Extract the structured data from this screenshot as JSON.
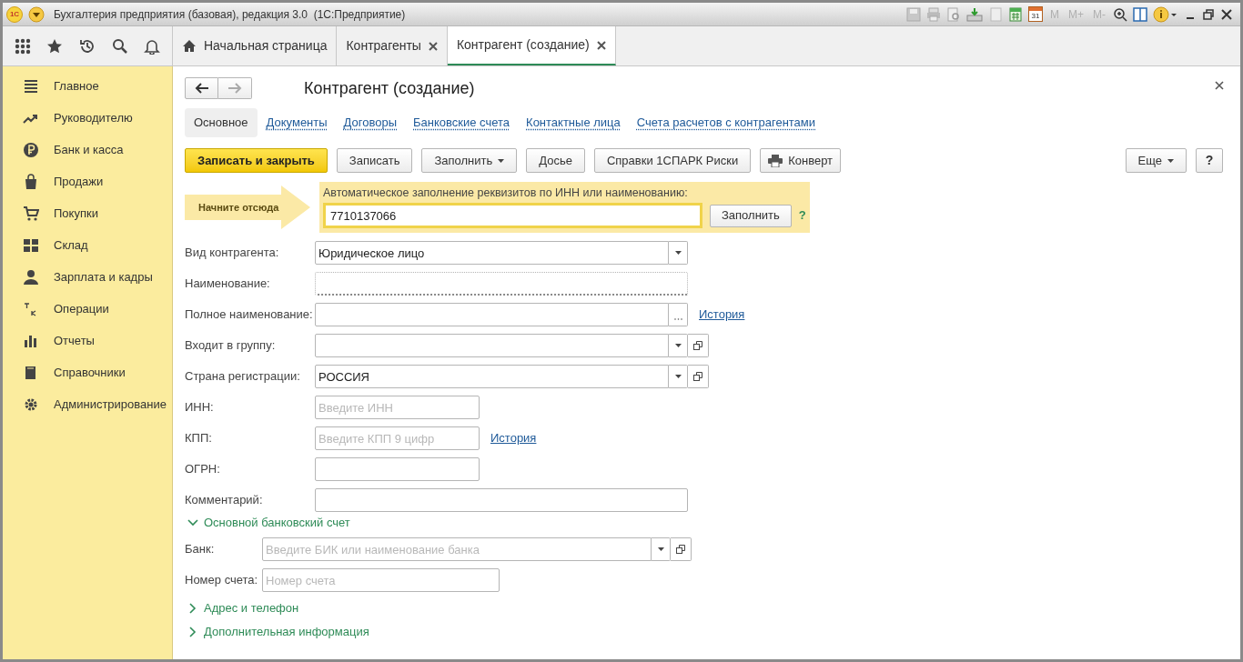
{
  "title_bar": {
    "logo": "1С",
    "title": "Бухгалтерия предприятия (базовая), редакция 3.0  (1С:Предприятие)",
    "calendar_day": "31",
    "memory_buttons": [
      "M",
      "M+",
      "M-"
    ]
  },
  "tabs": [
    {
      "label": "Начальная страница",
      "selected": false,
      "kind": "home"
    },
    {
      "label": "Контрагенты",
      "selected": false,
      "kind": "closable"
    },
    {
      "label": "Контрагент (создание)",
      "selected": true,
      "kind": "closable"
    }
  ],
  "sidebar": {
    "items": [
      "Главное",
      "Руководителю",
      "Банк и касса",
      "Продажи",
      "Покупки",
      "Склад",
      "Зарплата и кадры",
      "Операции",
      "Отчеты",
      "Справочники",
      "Администрирование"
    ]
  },
  "form": {
    "title": "Контрагент (создание)",
    "subtabs": [
      {
        "label": "Основное",
        "selected": true
      },
      {
        "label": "Документы",
        "selected": false
      },
      {
        "label": "Договоры",
        "selected": false
      },
      {
        "label": "Банковские счета",
        "selected": false
      },
      {
        "label": "Контактные лица",
        "selected": false
      },
      {
        "label": "Счета расчетов с контрагентами",
        "selected": false
      }
    ],
    "commands": [
      {
        "label": "Записать и закрыть",
        "kind": "primary"
      },
      {
        "label": "Записать",
        "kind": "plain"
      },
      {
        "label": "Заполнить",
        "kind": "menu"
      },
      {
        "label": "Досье",
        "kind": "plain"
      },
      {
        "label": "Справки 1СПАРК Риски",
        "kind": "plain"
      },
      {
        "label": "Конверт",
        "kind": "print"
      }
    ],
    "more_button": "Еще",
    "help_button": "?",
    "start_hint": "Начните отсюда",
    "autofill": {
      "label": "Автоматическое заполнение реквизитов по ИНН или наименованию:",
      "value": "7710137066",
      "button": "Заполнить",
      "help": "?"
    },
    "fields": [
      {
        "label": "Вид контрагента:",
        "kind": "select",
        "value": "Юридическое лицо",
        "required": false
      },
      {
        "label": "Наименование:",
        "kind": "input",
        "required": true
      },
      {
        "label": "Полное наименование:",
        "kind": "choice",
        "required": false,
        "link": "История"
      },
      {
        "label": "Входит в группу:",
        "kind": "reference",
        "required": false
      },
      {
        "label": "Страна регистрации:",
        "kind": "reference",
        "value": "РОССИЯ",
        "required": false
      },
      {
        "label": "ИНН:",
        "kind": "short",
        "placeholder": "Введите ИНН",
        "required": false
      },
      {
        "label": "КПП:",
        "kind": "short",
        "placeholder": "Введите КПП 9 цифр",
        "required": false,
        "link": "История"
      },
      {
        "label": "ОГРН:",
        "kind": "short",
        "required": false
      },
      {
        "label": "Комментарий:",
        "kind": "input",
        "required": false
      }
    ],
    "sections": [
      {
        "title": "Основной банковский счет",
        "expanded": true,
        "fields": [
          {
            "label": "Банк:",
            "kind": "reference",
            "placeholder": "Введите БИК или наименование банка",
            "required": false
          },
          {
            "label": "Номер счета:",
            "kind": "short",
            "placeholder": "Номер счета",
            "required": false
          }
        ]
      },
      {
        "title": "Адрес и телефон",
        "expanded": false
      },
      {
        "title": "Дополнительная информация",
        "expanded": false
      }
    ]
  }
}
